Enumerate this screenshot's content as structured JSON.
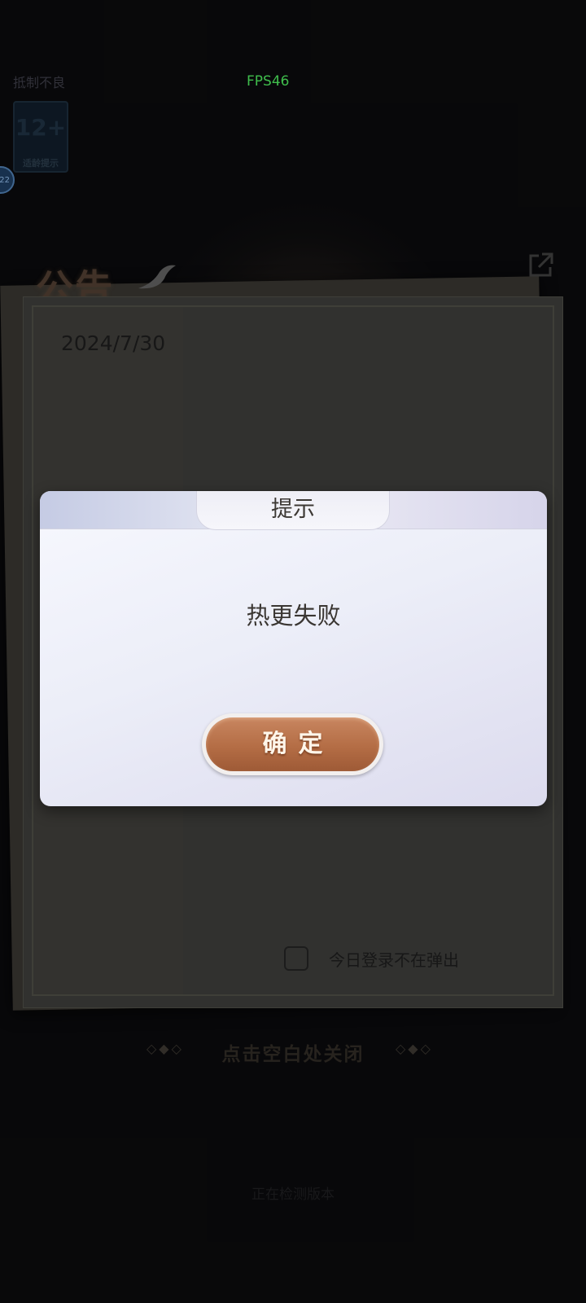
{
  "hud": {
    "fps": "FPS46",
    "age_rating_text": "抵制不良",
    "age_badge": "12+",
    "age_badge_sub": "适龄提示",
    "avatar_text": "22"
  },
  "notice": {
    "title": "公告",
    "date": "2024/7/30",
    "dont_show_today_label": "今日登录不在弹出",
    "close_hint": "点击空白处关闭",
    "diamond_left": "◇◆◇",
    "diamond_right": "◇◆◇"
  },
  "status": {
    "version_check": "正在检测版本"
  },
  "dialog": {
    "title": "提示",
    "message": "热更失败",
    "confirm_label": "确定"
  },
  "colors": {
    "fps": "#4ade5a",
    "button_brown": "#b46d45",
    "dialog_bg": "#eceef8"
  },
  "icons": {
    "external": "external-link-icon",
    "bird": "bird-icon"
  }
}
